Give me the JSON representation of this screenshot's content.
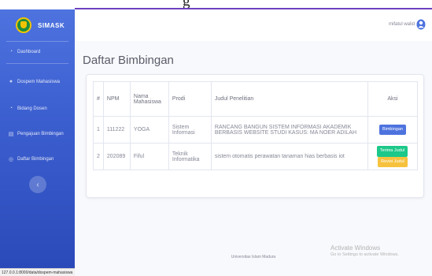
{
  "browser": {
    "partial_title": "g"
  },
  "sidebar": {
    "brand": "SIMASK",
    "items": [
      {
        "icon": "dashboard-icon",
        "label": "Dashboard"
      },
      {
        "icon": "users-icon",
        "label": "Dospem Mahasiswa"
      },
      {
        "icon": "dashboard-icon",
        "label": "Bidang Dosen"
      },
      {
        "icon": "document-icon",
        "label": "Pengajuan Bimbingan"
      },
      {
        "icon": "list-icon",
        "label": "Daftar Bimbingan"
      }
    ],
    "status_url": "127.0.0.1:8000/data/dospem-mahasiswa"
  },
  "topbar": {
    "user_name": "mifatul walid",
    "user_icon": "user-circle-icon"
  },
  "page": {
    "title": "Daftar Bimbingan"
  },
  "table": {
    "headers": [
      "#",
      "NPM",
      "Nama Mahasiswa",
      "Prodi",
      "Judul Penelitian",
      "Aksi"
    ],
    "rows": [
      {
        "no": "1",
        "npm": "111222",
        "nama": "YOGA",
        "prodi": "Sistem Informasi",
        "judul": "RANCANG BANGUN SISTEM INFORMASI AKADEMIK BERBASIS WEBSITE STUDI KASUS: MA NOER ADILAH",
        "actions": [
          "Bimbingan"
        ]
      },
      {
        "no": "2",
        "npm": "202089",
        "nama": "Fiful",
        "prodi": "Teknik Informatika",
        "judul": "sistem otomatis perawatan tanaman hias berbasis iot",
        "actions": [
          "Terima Judul",
          "Revisi Judul"
        ]
      }
    ]
  },
  "footer": {
    "text": "Universitas Islam Madura"
  },
  "watermark": {
    "line1": "Activate Windows",
    "line2": "Go to Settings to activate Windows."
  },
  "colors": {
    "primary": "#4e73df",
    "success": "#1cc88a",
    "warning": "#f6c23e"
  }
}
